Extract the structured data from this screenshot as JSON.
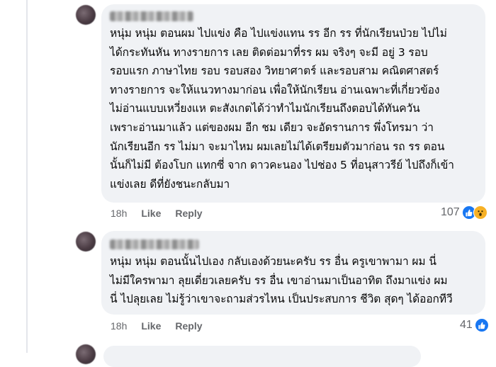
{
  "comments": [
    {
      "author": "",
      "text": "หนุ่ม หนุ่ม ตอนผม ไปแข่ง คือ ไปแข่งแทน รร อีก รร ที่นักเรียนป่วย ไปไม่\nได้กระทันหัน ทางรายการ เลย ติดต่อมาที่รร ผม  จริงๆ จะมี อยู่ 3 รอบ\nรอบแรก ภาษาไทย รอบ รอบสอง วิทยาศาตร์ และรอบสาม คณิตศาสตร์\nทางรายการ จะให้แนวทางมาก่อน เพื่อให้นักเรียน อ่านเฉพาะที่เกี่ยวข้อง\nไม่อ่านแบบเหวี่ยงแห ตะสังเกตได้ว่าทำไมนักเรียนถึงตอบได้ทันควัน\nเพราะอ่านมาแล้ว แต่ของผม อีก ชม เดียว จะอัดรานการ พึ่งโทรมา ว่า\nนักเรียนอีก รร ไม่มา จะมาไหม ผมเลยไม่ได้เตรียมตัวมาก่อน รถ รร ตอน\nนั้นก็ไม่มี ต้องโบก แทกซี่ จาก ดาวคะนอง ไปช่อง 5 ที่อนุสาวรีย์ ไปถึงก็เข้า\nแข่งเลย ดีที่ยังชนะกลับมา",
      "time": "18h",
      "like_label": "Like",
      "reply_label": "Reply",
      "reaction_count": "107",
      "reactions": [
        "like-icon",
        "wow-icon"
      ]
    },
    {
      "author": "",
      "text": "หนุ่ม หนุ่ม ตอนนั้นไปเอง กลับเองด้วยนะครับ รร อื่น ครูเขาพามา ผม นี่\nไม่มีใครพามา ลุยเดี่ยวเลยครับ รร อื่น เขาอ่านมาเป็นอาทิต ถึงมาแข่ง ผม\nนี่ ไปลุยเลย ไม่รู้ว่าเขาจะถามส่วรไหน เป็นประสบการ ชีวิต สุดๆ ได้ออกทีวี",
      "time": "18h",
      "like_label": "Like",
      "reply_label": "Reply",
      "reaction_count": "41",
      "reactions": [
        "like-icon"
      ]
    }
  ],
  "colors": {
    "bubble": "#f0f2f5",
    "meta_text": "#65676b",
    "like_blue": "#1877f2",
    "wow_yellow": "#f7b125"
  }
}
